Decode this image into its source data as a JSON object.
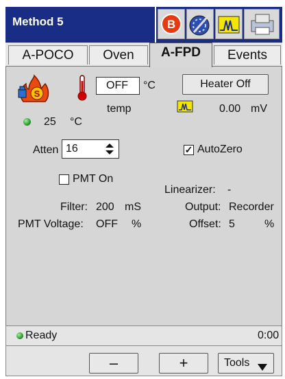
{
  "window": {
    "title": "Method 5"
  },
  "tabs": [
    {
      "label": "A-POCO"
    },
    {
      "label": "Oven"
    },
    {
      "label": "A-FPD",
      "active": true
    },
    {
      "label": "Events"
    }
  ],
  "heater": {
    "setpoint": "OFF",
    "unit": "°C",
    "temp_label": "temp",
    "actual_value": "25",
    "actual_unit": "°C",
    "button_label": "Heater Off"
  },
  "signal": {
    "value": "0.00",
    "unit": "mV"
  },
  "atten": {
    "label": "Atten",
    "value": "16"
  },
  "autozero": {
    "label": "AutoZero",
    "checked": true
  },
  "pmt": {
    "label": "PMT On",
    "checked": false
  },
  "linearizer": {
    "label": "Linearizer:",
    "value": "-"
  },
  "filter": {
    "label": "Filter:",
    "value": "200",
    "unit": "mS"
  },
  "output": {
    "label": "Output:",
    "value": "Recorder"
  },
  "pmt_voltage": {
    "label": "PMT Voltage:",
    "value": "OFF",
    "unit": "%"
  },
  "offset": {
    "label": "Offset:",
    "value": "5",
    "unit": "%"
  },
  "status": {
    "text": "Ready",
    "time": "0:00"
  },
  "bottom": {
    "minus": "–",
    "plus": "+",
    "tools": "Tools"
  },
  "icons": [
    "b-icon",
    "wrench-icon",
    "chromatogram-icon",
    "printer-icon",
    "flame-s-icon",
    "thermometer-icon"
  ],
  "colors": {
    "titlebar": "#1a2d86",
    "led": "#2e9e2e",
    "flame": "#e84a10"
  }
}
